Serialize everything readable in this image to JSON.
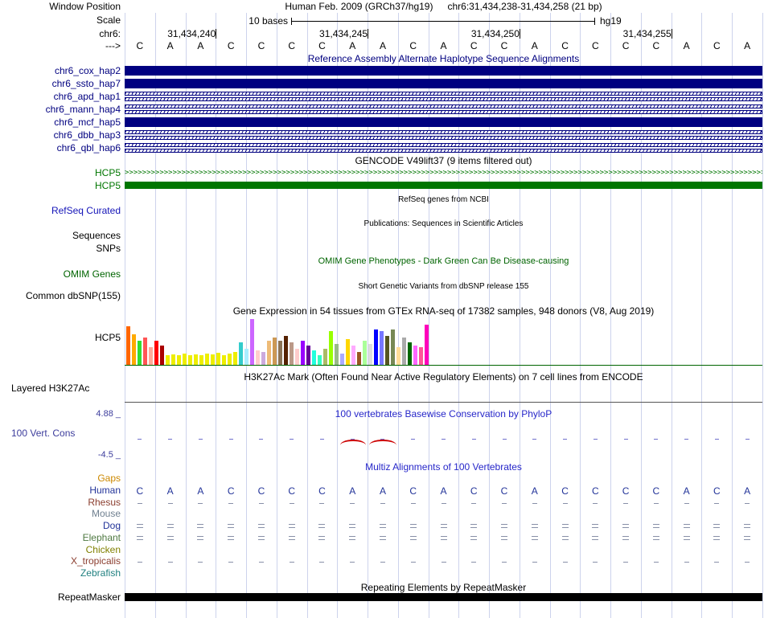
{
  "header": {
    "window_position_label": "Window Position",
    "assembly": "Human Feb. 2009 (GRCh37/hg19)",
    "position": "chr6:31,434,238-31,434,258 (21 bp)",
    "scale_label": "Scale",
    "scale_text": "10 bases",
    "genome": "hg19",
    "chrom": "chr6:",
    "strand": "--->"
  },
  "ruler": {
    "ticks": [
      {
        "label": "31,434,240",
        "base_index": 2
      },
      {
        "label": "31,434,245",
        "base_index": 7
      },
      {
        "label": "31,434,250",
        "base_index": 12
      },
      {
        "label": "31,434,255",
        "base_index": 17
      }
    ]
  },
  "sequence": {
    "bases": [
      "C",
      "A",
      "A",
      "C",
      "C",
      "C",
      "C",
      "A",
      "A",
      "C",
      "A",
      "C",
      "C",
      "A",
      "C",
      "C",
      "C",
      "C",
      "A",
      "C",
      "A"
    ]
  },
  "tracks": {
    "haplotypes": {
      "title": "Reference Assembly Alternate Haplotype Sequence Alignments",
      "items": [
        {
          "label": "chr6_cox_hap2",
          "display": "solid"
        },
        {
          "label": "chr6_ssto_hap7",
          "display": "solid"
        },
        {
          "label": "chr6_apd_hap1",
          "display": "chevron"
        },
        {
          "label": "chr6_mann_hap4",
          "display": "chevron"
        },
        {
          "label": "chr6_mcf_hap5",
          "display": "solid"
        },
        {
          "label": "chr6_dbb_hap3",
          "display": "chevron"
        },
        {
          "label": "chr6_qbl_hap6",
          "display": "chevron"
        }
      ]
    },
    "gencode": {
      "title": "GENCODE V49lift37 (9 items filtered out)",
      "gene": "HCP5"
    },
    "refseq": {
      "title": "RefSeq genes from NCBI",
      "label": "RefSeq Curated"
    },
    "publications": {
      "title": "Publications: Sequences in Scientific Articles",
      "labels": [
        "Sequences",
        "SNPs"
      ]
    },
    "omim": {
      "title": "OMIM Gene Phenotypes - Dark Green Can Be Disease-causing",
      "label": "OMIM Genes"
    },
    "dbsnp": {
      "title": "Short Genetic Variants from dbSNP release 155",
      "label": "Common dbSNP(155)"
    },
    "gtex": {
      "title": "Gene Expression in 54 tissues from GTEx RNA-seq of 17382 samples, 948 donors (V8, Aug 2019)",
      "label": "HCP5"
    },
    "h3k27ac": {
      "title": "H3K27Ac Mark (Often Found Near Active Regulatory Elements) on 7 cell lines from ENCODE",
      "label": "Layered H3K27Ac"
    },
    "phylop": {
      "title": "100 vertebrates Basewise Conservation by PhyloP",
      "label": "100 Vert. Cons",
      "max": "4.88 _",
      "min": "-4.5 _",
      "arcs": [
        {
          "start": 7.1,
          "end": 7.95
        },
        {
          "start": 8.05,
          "end": 8.95
        }
      ]
    },
    "multiz": {
      "title": "Multiz Alignments of 100 Vertebrates",
      "rows": [
        {
          "label": "Gaps",
          "color": "#CC8800",
          "marks": "none"
        },
        {
          "label": "Human",
          "color": "#223399",
          "marks": "bases"
        },
        {
          "label": "Rhesus",
          "color": "#8B3E2F",
          "marks": "dash"
        },
        {
          "label": "Mouse",
          "color": "#708090",
          "marks": "none"
        },
        {
          "label": "Dog",
          "color": "#223399",
          "marks": "equals"
        },
        {
          "label": "Elephant",
          "color": "#4F7942",
          "marks": "equals"
        },
        {
          "label": "Chicken",
          "color": "#808000",
          "marks": "none"
        },
        {
          "label": "X_tropicalis",
          "color": "#8B3E2F",
          "marks": "dash"
        },
        {
          "label": "Zebrafish",
          "color": "#208080",
          "marks": "none"
        }
      ]
    },
    "repeatmasker": {
      "title": "Repeating Elements by RepeatMasker",
      "label": "RepeatMasker"
    }
  },
  "chart_data": {
    "type": "bar",
    "title": "Gene Expression in 54 tissues from GTEx RNA-seq of 17382 samples, 948 donors (V8, Aug 2019)",
    "gene": "HCP5",
    "values": [
      48,
      38,
      30,
      34,
      22,
      30,
      24,
      12,
      13,
      12,
      14,
      12,
      13,
      12,
      14,
      13,
      15,
      12,
      14,
      16,
      28,
      20,
      57,
      18,
      16,
      30,
      34,
      30,
      36,
      28,
      20,
      30,
      24,
      18,
      12,
      20,
      42,
      26,
      14,
      32,
      24,
      16,
      30,
      26,
      44,
      42,
      36,
      44,
      22,
      34,
      28,
      24,
      22,
      50
    ],
    "colors": [
      "#FF6600",
      "#FFAA00",
      "#33DD33",
      "#FF5555",
      "#FFAA99",
      "#FF0000",
      "#AA0000",
      "#EEEE00",
      "#EEEE00",
      "#EEEE00",
      "#EEEE00",
      "#EEEE00",
      "#EEEE00",
      "#EEEE00",
      "#EEEE00",
      "#EEEE00",
      "#EEEE00",
      "#EEEE00",
      "#EEEE00",
      "#EEEE00",
      "#33CCCC",
      "#AAEEFF",
      "#CC66FF",
      "#FFCCCC",
      "#CCAADD",
      "#EEBB77",
      "#CC9955",
      "#8B7355",
      "#552200",
      "#BB9988",
      "#FFCCCC",
      "#9900FF",
      "#660099",
      "#22FFDD",
      "#33FFC2",
      "#AABB66",
      "#99FF00",
      "#99BB88",
      "#AAAAFF",
      "#FFD700",
      "#FFAAFF",
      "#995522",
      "#AAFF99",
      "#DDDDDD",
      "#0000FF",
      "#7777FF",
      "#555522",
      "#778855",
      "#FFDD99",
      "#AAAAAA",
      "#006600",
      "#FF66FF",
      "#FF5599",
      "#FF00BB"
    ]
  },
  "colors": {
    "grid": "#CDD3EC",
    "navy": "#000080",
    "gene_green": "#007600",
    "omim_green": "#006400",
    "title_blue": "#2626C9",
    "refseq_blue": "#1414B8",
    "slate_blue": "#3C3C9C",
    "gaps_orange": "#CC8800",
    "mark_gray": "#8890A8",
    "phylop_pos": "#7070CC",
    "phylop_neg": "#CC0000"
  }
}
